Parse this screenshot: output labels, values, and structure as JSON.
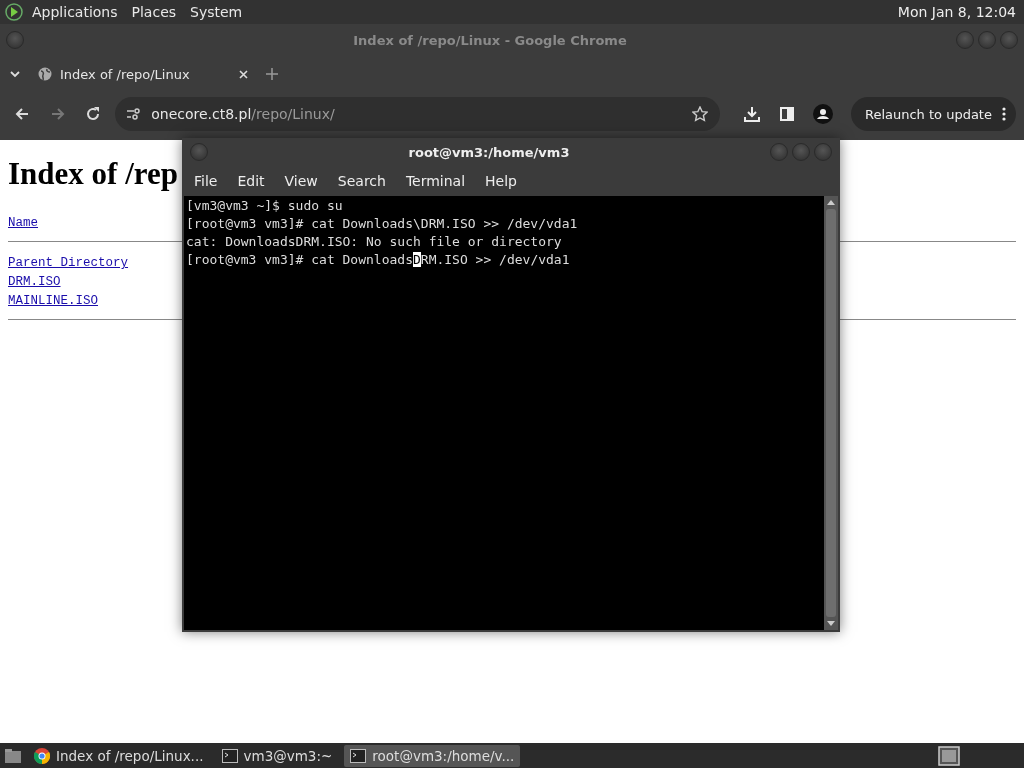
{
  "top_panel": {
    "menus": [
      "Applications",
      "Places",
      "System"
    ],
    "clock": "Mon Jan  8, 12:04"
  },
  "browser": {
    "window_title": "Index of /repo/Linux - Google Chrome",
    "tabs": [
      {
        "label": "Index of /repo/Linux",
        "selected": true
      }
    ],
    "address": {
      "host": "onecore.ct8.pl",
      "path": "/repo/Linux/"
    },
    "forward_disabled": true,
    "relaunch_button": "Relaunch to update",
    "page": {
      "heading": "Index of /rep",
      "column_header": "Name",
      "links": [
        "Parent Directory",
        "DRM.ISO",
        "MAINLINE.ISO"
      ]
    }
  },
  "terminal": {
    "title": "root@vm3:/home/vm3",
    "menus": [
      "File",
      "Edit",
      "View",
      "Search",
      "Terminal",
      "Help"
    ],
    "lines": [
      {
        "text": "[vm3@vm3 ~]$ sudo su"
      },
      {
        "text": "[root@vm3 vm3]# cat Downloads\\DRM.ISO >> /dev/vda1"
      },
      {
        "text": "cat: DownloadsDRM.ISO: No such file or directory"
      },
      {
        "text": "[root@vm3 vm3]# cat Downloads",
        "cursor": "D",
        "after": "RM.ISO >> /dev/vda1"
      }
    ]
  },
  "taskbar": {
    "items": [
      {
        "label": "Index of /repo/Linux...",
        "kind": "browser",
        "selected": false
      },
      {
        "label": "vm3@vm3:~",
        "kind": "terminal",
        "selected": false
      },
      {
        "label": "root@vm3:/home/v...",
        "kind": "terminal",
        "selected": true
      }
    ]
  }
}
